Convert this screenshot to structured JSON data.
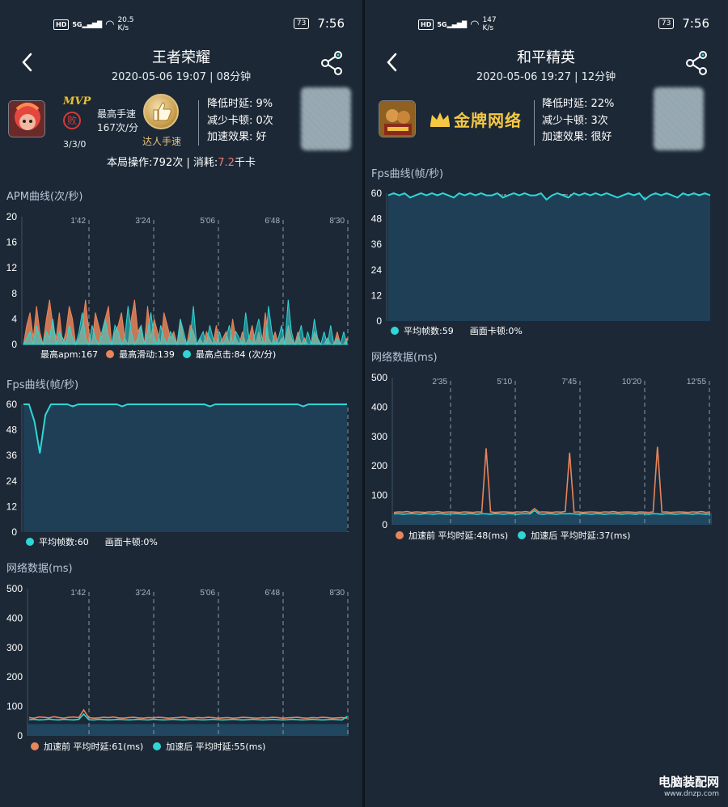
{
  "status_left": {
    "net": "HD",
    "signal": "5G",
    "speed": "20.5",
    "speed_unit": "K/s",
    "battery": "73",
    "time": "7:56"
  },
  "status_right": {
    "net": "HD",
    "signal": "5G",
    "speed": "147",
    "speed_unit": "K/s",
    "battery": "73",
    "time": "7:56"
  },
  "left": {
    "title": "王者荣耀",
    "subtitle": "2020-05-06 19:07 | 08分钟",
    "mvp": "MVP",
    "result": "败",
    "kda": "3/3/0",
    "speed_title": "最高手速",
    "speed_value": "167次/分",
    "medal_label": "达人手速",
    "stat1": "降低时延:  9%",
    "stat2": "减少卡顿:  0次",
    "stat3": "加速效果:  好",
    "ops_text": "本局操作:792次  |  消耗:",
    "ops_value": "7.2",
    "ops_unit": "千卡",
    "apm_title": "APM曲线(次/秒)",
    "apm_legend1": "最高apm:167",
    "apm_legend2": "最高滑动:139",
    "apm_legend3": "最高点击:84 (次/分)",
    "fps_title": "Fps曲线(帧/秒)",
    "fps_legend1": "平均帧数:60",
    "fps_legend2": "画面卡顿:0%",
    "net_title": "网络数据(ms)",
    "net_legend1": "加速前  平均时延:61(ms)",
    "net_legend2": "加速后  平均时延:55(ms)"
  },
  "right": {
    "title": "和平精英",
    "subtitle": "2020-05-06 19:27 | 12分钟",
    "brand": "金牌网络",
    "stat1": "降低时延:  22%",
    "stat2": "减少卡顿:  3次",
    "stat3": "加速效果:  很好",
    "fps_title": "Fps曲线(帧/秒)",
    "fps_legend1": "平均帧数:59",
    "fps_legend2": "画面卡顿:0%",
    "net_title": "网络数据(ms)",
    "net_legend1": "加速前  平均时延:48(ms)",
    "net_legend2": "加速后  平均时延:37(ms)"
  },
  "watermark": {
    "main": "电脑装配网",
    "sub": "www.dnzp.com"
  },
  "colors": {
    "orange": "#e8855a",
    "cyan": "#2fd6d6",
    "fill": "#1f3f57",
    "bg": "#1c2836"
  },
  "icons": [
    "back-arrow-icon",
    "share-icon",
    "thumbs-up-icon",
    "crown-icon"
  ],
  "chart_data": [
    {
      "id": "left-apm",
      "type": "area",
      "title": "APM曲线(次/秒)",
      "x_ticks": [
        "1'42",
        "3'24",
        "5'06",
        "6'48",
        "8'30"
      ],
      "y_ticks": [
        0,
        4,
        8,
        12,
        16,
        20
      ],
      "ylim": [
        0,
        20
      ],
      "series": [
        {
          "name": "最高滑动:139",
          "color": "#e8855a",
          "values": [
            0,
            3,
            5,
            1,
            6,
            2,
            0,
            4,
            7,
            3,
            1,
            5,
            0,
            2,
            6,
            4,
            0,
            1,
            3,
            7,
            2,
            0,
            5,
            3,
            1,
            4,
            6,
            0,
            2,
            3,
            5,
            1,
            0,
            4,
            7,
            2,
            3,
            0,
            6,
            1,
            4,
            2,
            0,
            5,
            3,
            1,
            2,
            0,
            4,
            1,
            0,
            3,
            2,
            0,
            1,
            0,
            2,
            1,
            0,
            3,
            0,
            1,
            2,
            0,
            4,
            1,
            0,
            2,
            0,
            1,
            3,
            0,
            2,
            0,
            5,
            1,
            0,
            2,
            0,
            1,
            0,
            3,
            1,
            0,
            2,
            0,
            1,
            0,
            0,
            2,
            1,
            0,
            0,
            1,
            0,
            0,
            2,
            0,
            0,
            1
          ]
        },
        {
          "name": "最高点击:84 (次/分)",
          "color": "#2fd6d6",
          "values": [
            0,
            1,
            2,
            0,
            3,
            1,
            0,
            2,
            1,
            4,
            0,
            2,
            1,
            0,
            3,
            1,
            0,
            2,
            5,
            1,
            0,
            3,
            1,
            0,
            2,
            4,
            1,
            0,
            3,
            2,
            0,
            1,
            6,
            2,
            0,
            1,
            3,
            0,
            2,
            5,
            1,
            0,
            3,
            1,
            0,
            2,
            1,
            0,
            4,
            2,
            0,
            1,
            6,
            0,
            1,
            2,
            0,
            3,
            1,
            0,
            2,
            0,
            1,
            3,
            0,
            2,
            1,
            0,
            5,
            1,
            0,
            2,
            4,
            1,
            0,
            6,
            2,
            0,
            1,
            3,
            0,
            7,
            2,
            0,
            1,
            3,
            0,
            2,
            0,
            4,
            1,
            0,
            2,
            0,
            3,
            0,
            1,
            0,
            2,
            0
          ]
        }
      ]
    },
    {
      "id": "left-fps",
      "type": "area",
      "title": "Fps曲线(帧/秒)",
      "x_ticks": [
        "1'42",
        "3'24",
        "5'06",
        "6'48",
        "8'30"
      ],
      "y_ticks": [
        0,
        12,
        24,
        36,
        48,
        60
      ],
      "ylim": [
        0,
        60
      ],
      "series": [
        {
          "name": "平均帧数:60",
          "color": "#2fd6d6",
          "values": [
            60,
            60,
            52,
            37,
            55,
            60,
            60,
            60,
            60,
            59,
            60,
            60,
            60,
            60,
            60,
            60,
            60,
            60,
            59,
            60,
            60,
            60,
            60,
            60,
            60,
            60,
            60,
            60,
            60,
            60,
            60,
            60,
            60,
            60,
            59,
            60,
            60,
            60,
            60,
            60,
            60,
            60,
            60,
            60,
            60,
            60,
            60,
            60,
            60,
            60,
            60,
            59,
            60,
            60,
            60,
            60,
            60,
            60,
            60,
            60
          ]
        }
      ]
    },
    {
      "id": "left-net",
      "type": "line",
      "title": "网络数据(ms)",
      "x_ticks": [
        "1'42",
        "3'24",
        "5'06",
        "6'48",
        "8'30"
      ],
      "y_ticks": [
        0,
        100,
        200,
        300,
        400,
        500
      ],
      "ylim": [
        0,
        500
      ],
      "series": [
        {
          "name": "加速前  平均时延:61(ms)",
          "color": "#e8855a",
          "values": [
            62,
            60,
            64,
            63,
            61,
            65,
            62,
            60,
            63,
            64,
            62,
            88,
            62,
            60,
            61,
            63,
            62,
            64,
            61,
            60,
            62,
            63,
            61,
            60,
            62,
            61,
            63,
            62,
            60,
            61,
            62,
            64,
            61,
            60,
            62,
            61,
            63,
            62,
            60,
            61,
            62,
            60,
            61,
            63,
            62,
            61,
            60,
            62,
            61,
            63,
            62,
            60,
            61,
            62,
            63,
            61,
            60,
            62,
            61,
            63,
            62,
            60,
            61,
            62,
            60
          ]
        },
        {
          "name": "加速后  平均时延:55(ms)",
          "color": "#2fd6d6",
          "values": [
            55,
            56,
            54,
            55,
            57,
            55,
            54,
            56,
            55,
            54,
            56,
            74,
            55,
            54,
            56,
            55,
            54,
            55,
            56,
            55,
            54,
            55,
            56,
            55,
            54,
            56,
            55,
            54,
            55,
            56,
            55,
            54,
            55,
            56,
            55,
            54,
            55,
            56,
            55,
            54,
            55,
            56,
            55,
            54,
            55,
            56,
            55,
            54,
            55,
            56,
            55,
            54,
            55,
            56,
            55,
            54,
            55,
            56,
            55,
            54,
            55,
            56,
            55,
            54,
            66
          ]
        }
      ]
    },
    {
      "id": "right-fps",
      "type": "area",
      "title": "Fps曲线(帧/秒)",
      "x_ticks": [
        "2'35",
        "5'10",
        "7'45",
        "10'20",
        "12'55"
      ],
      "y_ticks": [
        0,
        12,
        24,
        36,
        48,
        60
      ],
      "ylim": [
        0,
        60
      ],
      "series": [
        {
          "name": "平均帧数:59",
          "color": "#2fd6d6",
          "values": [
            59,
            60,
            59,
            60,
            58,
            59,
            60,
            59,
            60,
            59,
            60,
            59,
            58,
            60,
            59,
            60,
            59,
            60,
            59,
            59,
            60,
            58,
            59,
            60,
            59,
            60,
            59,
            59,
            60,
            57,
            59,
            60,
            59,
            58,
            60,
            59,
            60,
            59,
            60,
            59,
            60,
            59,
            58,
            59,
            60,
            59,
            60,
            57,
            59,
            60,
            59,
            60,
            59,
            58,
            60,
            59,
            60,
            59,
            60,
            59
          ]
        }
      ]
    },
    {
      "id": "right-net",
      "type": "line",
      "title": "网络数据(ms)",
      "x_ticks": [
        "2'35",
        "5'10",
        "7'45",
        "10'20",
        "12'55"
      ],
      "y_ticks": [
        0,
        100,
        200,
        300,
        400,
        500
      ],
      "ylim": [
        0,
        500
      ],
      "series": [
        {
          "name": "加速前  平均时延:48(ms)",
          "color": "#e8855a",
          "values": [
            42,
            44,
            43,
            45,
            42,
            44,
            43,
            42,
            44,
            43,
            45,
            42,
            43,
            44,
            43,
            42,
            44,
            43,
            42,
            44,
            43,
            260,
            44,
            42,
            43,
            44,
            43,
            42,
            44,
            43,
            45,
            42,
            55,
            43,
            44,
            43,
            42,
            44,
            43,
            45,
            245,
            43,
            44,
            42,
            43,
            44,
            43,
            42,
            44,
            43,
            45,
            42,
            43,
            44,
            43,
            42,
            44,
            43,
            42,
            44,
            265,
            43,
            44,
            42,
            43,
            44,
            43,
            42,
            44,
            43,
            45,
            42,
            44
          ]
        },
        {
          "name": "加速后  平均时延:37(ms)",
          "color": "#2fd6d6",
          "values": [
            37,
            38,
            36,
            37,
            38,
            37,
            36,
            38,
            37,
            36,
            38,
            37,
            36,
            37,
            38,
            37,
            36,
            38,
            37,
            36,
            38,
            37,
            36,
            38,
            37,
            36,
            38,
            37,
            36,
            37,
            38,
            37,
            48,
            37,
            36,
            38,
            37,
            36,
            38,
            37,
            38,
            37,
            36,
            38,
            37,
            36,
            38,
            37,
            36,
            37,
            38,
            37,
            36,
            38,
            37,
            36,
            38,
            37,
            36,
            38,
            37,
            36,
            38,
            37,
            36,
            37,
            38,
            37,
            36,
            38,
            37,
            36,
            37
          ]
        }
      ]
    }
  ]
}
